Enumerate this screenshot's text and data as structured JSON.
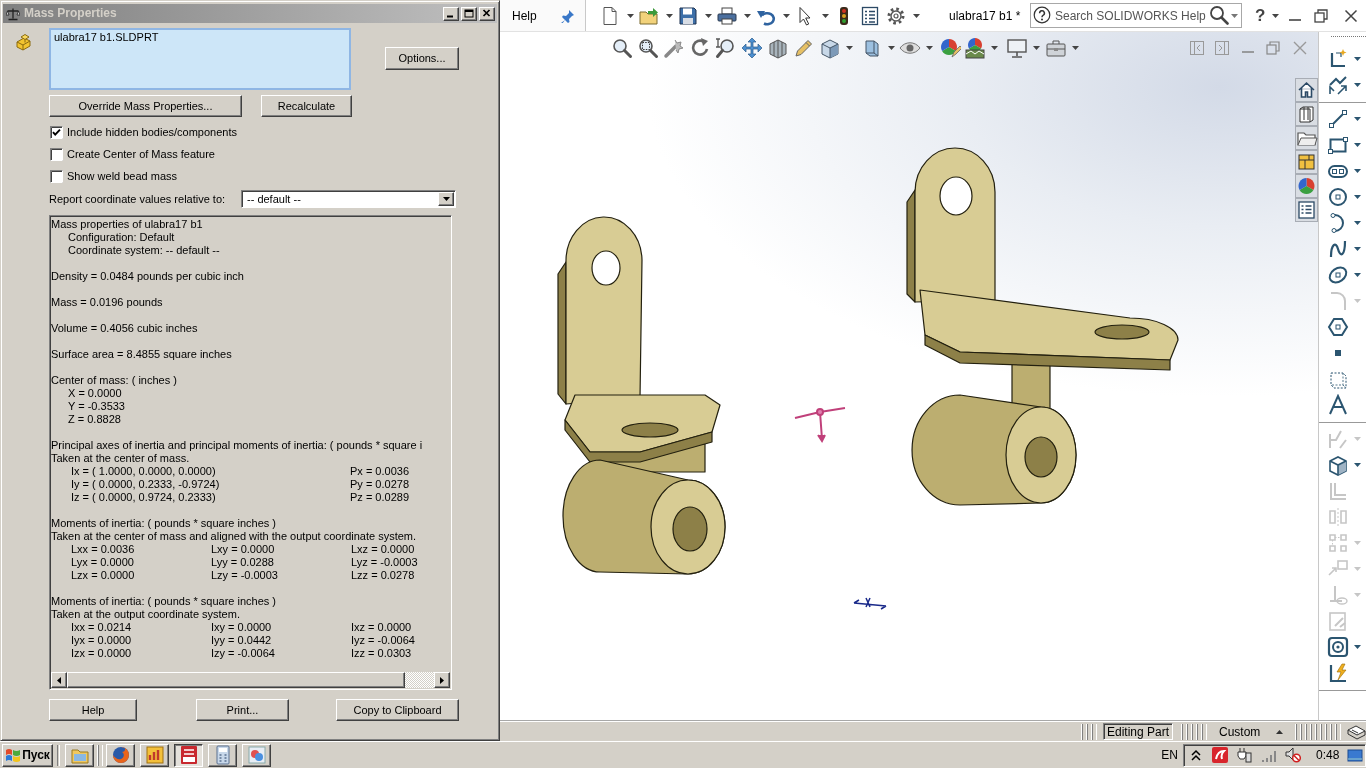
{
  "dialog": {
    "title": "Mass Properties",
    "selection_list": {
      "items": [
        "ulabra17 b1.SLDPRT"
      ]
    },
    "options_button": "Options...",
    "override_button": "Override Mass Properties...",
    "recalculate_button": "Recalculate",
    "checkboxes": [
      {
        "label": "Include hidden bodies/components",
        "checked": true
      },
      {
        "label": "Create Center of Mass feature",
        "checked": false
      },
      {
        "label": "Show weld bead mass",
        "checked": false
      }
    ],
    "coordinate_select": {
      "label": "Report coordinate values relative to:",
      "value": "-- default --"
    },
    "report": {
      "sections": [
        {
          "lines": [
            "Mass properties of ulabra17 b1"
          ],
          "children": [
            "Configuration: Default",
            "Coordinate system: -- default --"
          ]
        },
        {
          "lines": [
            "Density = 0.0484 pounds per cubic inch"
          ]
        },
        {
          "lines": [
            "Mass = 0.0196 pounds"
          ]
        },
        {
          "lines": [
            "Volume = 0.4056 cubic inches"
          ]
        },
        {
          "lines": [
            "Surface area = 8.4855 square inches"
          ]
        },
        {
          "lines": [
            "Center of mass: ( inches )"
          ],
          "children": [
            "X = 0.0000",
            "Y = -0.3533",
            "Z = 0.8828"
          ]
        },
        {
          "lines": [
            "Principal axes of inertia and principal moments of inertia: ( pounds * square i",
            "Taken at the center of mass."
          ],
          "rows": [
            [
              "Ix = ( 1.0000, 0.0000, 0.0000)",
              "Px = 0.0036"
            ],
            [
              "Iy = ( 0.0000, 0.2333, -0.9724)",
              "Py = 0.0278"
            ],
            [
              "Iz = ( 0.0000, 0.9724, 0.2333)",
              "Pz = 0.0289"
            ]
          ]
        },
        {
          "lines": [
            "Moments of inertia: ( pounds * square inches )",
            "Taken at the center of mass and aligned with the output coordinate system."
          ],
          "rows": [
            [
              "Lxx = 0.0036",
              "Lxy = 0.0000",
              "Lxz = 0.0000"
            ],
            [
              "Lyx = 0.0000",
              "Lyy = 0.0288",
              "Lyz = -0.0003"
            ],
            [
              "Lzx = 0.0000",
              "Lzy = -0.0003",
              "Lzz = 0.0278"
            ]
          ]
        },
        {
          "lines": [
            "Moments of inertia: ( pounds * square inches )",
            "Taken at the output coordinate system."
          ],
          "rows": [
            [
              "Ixx = 0.0214",
              "Ixy = 0.0000",
              "Ixz = 0.0000"
            ],
            [
              "Iyx = 0.0000",
              "Iyy = 0.0442",
              "Iyz = -0.0064"
            ],
            [
              "Izx = 0.0000",
              "Izy = -0.0064",
              "Izz = 0.0303"
            ]
          ]
        }
      ]
    },
    "footer_buttons": [
      "Help",
      "Print...",
      "Copy to Clipboard"
    ]
  },
  "sw": {
    "help_tab": "Help",
    "document_title": "ulabra17 b1 *",
    "search": {
      "placeholder": "Search SOLIDWORKS Help"
    },
    "help_menu": "?",
    "sketch_tools": [
      {
        "disabled": false
      },
      {
        "disabled": false
      },
      {
        "disabled": false
      },
      {
        "disabled": false
      },
      {
        "disabled": false
      },
      {
        "disabled": false
      },
      {
        "disabled": false
      },
      {
        "disabled": false
      },
      {
        "disabled": false
      },
      {
        "disabled": true
      },
      {
        "disabled": false
      },
      {
        "disabled": false
      },
      {
        "disabled": false
      },
      {
        "disabled": false
      },
      {
        "disabled": true
      },
      {
        "disabled": false
      },
      {
        "disabled": true
      },
      {
        "disabled": true
      },
      {
        "disabled": true
      },
      {
        "disabled": true
      },
      {
        "disabled": true
      },
      {
        "disabled": true
      },
      {
        "disabled": false
      },
      {
        "disabled": false
      }
    ]
  },
  "status_bar": {
    "mode": "Editing Part",
    "units": "Custom"
  },
  "taskbar": {
    "start_label": "Пуск",
    "tasks": [
      {
        "selected": false
      },
      {
        "selected": false
      },
      {
        "selected": false
      },
      {
        "selected": true
      },
      {
        "selected": false
      },
      {
        "selected": false
      }
    ],
    "language": "EN",
    "clock": "0:48"
  }
}
